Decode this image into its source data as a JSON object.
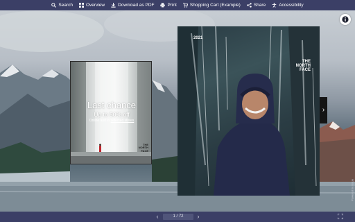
{
  "toolbar": {
    "items": [
      {
        "label": "Search",
        "icon": "search-icon"
      },
      {
        "label": "Overview",
        "icon": "grid-icon"
      },
      {
        "label": "Download as PDF",
        "icon": "download-icon"
      },
      {
        "label": "Print",
        "icon": "printer-icon"
      },
      {
        "label": "Shopping Cart (Example)",
        "icon": "cart-icon"
      },
      {
        "label": "Share",
        "icon": "share-icon"
      },
      {
        "label": "Accessibility",
        "icon": "accessibility-icon"
      }
    ]
  },
  "flyer": {
    "title": "Last chance",
    "subtitle": "Up to 50% off",
    "small_prefix": "Online and in",
    "small_link": "selected stores",
    "logo_line1": "THE",
    "logo_line2": "NORTH",
    "logo_line3": "FACE"
  },
  "cover": {
    "year": "2021",
    "logo_line1": "THE",
    "logo_line2": "NORTH",
    "logo_line3": "FACE"
  },
  "pagination": {
    "current": "1 / 72"
  },
  "side_tab": {
    "label": "Powered by Issuu"
  },
  "colors": {
    "bar": "#3b3f66",
    "page_box": "#50557a"
  }
}
